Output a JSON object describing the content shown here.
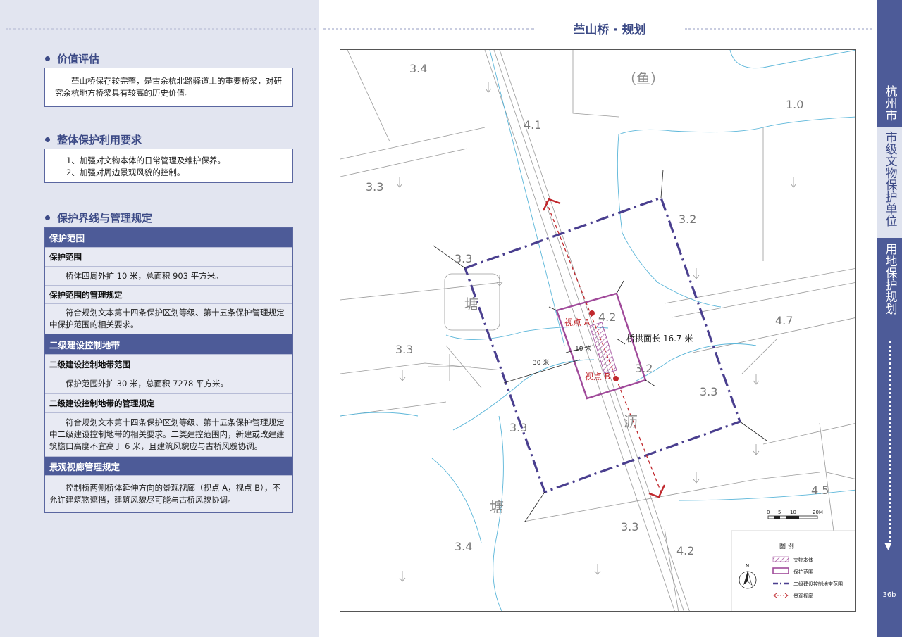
{
  "page_title": "苎山桥 · 规划",
  "sections": {
    "value": {
      "title": "价值评估",
      "text": "苎山桥保存较完整，是古余杭北路驿道上的重要桥梁，对研究余杭地方桥梁具有较高的历史价值。"
    },
    "overall": {
      "title": "整体保护利用要求",
      "items": [
        "1、加强对文物本体的日常管理及维护保养。",
        "2、加强对周边景观风貌的控制。"
      ]
    },
    "boundary": {
      "title": "保护界线与管理规定",
      "rows": [
        {
          "kind": "cat",
          "text": "保护范围"
        },
        {
          "kind": "sub",
          "text": "保护范围"
        },
        {
          "kind": "txt",
          "text": "桥体四周外扩 10 米，总面积 903 平方米。"
        },
        {
          "kind": "sub",
          "text": "保护范围的管理规定"
        },
        {
          "kind": "txt",
          "text": "符合规划文本第十四条保护区划等级、第十五条保护管理规定中保护范围的相关要求。"
        },
        {
          "kind": "cat",
          "text": "二级建设控制地带"
        },
        {
          "kind": "sub",
          "text": "二级建设控制地带范围"
        },
        {
          "kind": "txt",
          "text": "保护范围外扩 30 米，总面积 7278 平方米。"
        },
        {
          "kind": "sub",
          "text": "二级建设控制地带的管理规定"
        },
        {
          "kind": "txt",
          "text": "符合规划文本第十四条保护区划等级、第十五条保护管理规定中二级建设控制地带的相关要求。二类建控范围内，新建或改建建筑檐口高度不宜高于 6 米，且建筑风貌应与古桥风貌协调。"
        },
        {
          "kind": "cat",
          "text": "景观视廊管理规定"
        },
        {
          "kind": "txt",
          "text": "控制桥两侧桥体延伸方向的景观视廊（视点 A，视点 B），不允许建筑物遮挡，建筑风貌尽可能与古桥风貌协调。"
        }
      ]
    }
  },
  "map": {
    "elevations": [
      "3.4",
      "1.0",
      "4.1",
      "3.3",
      "3.2",
      "3.3",
      "4.2",
      "4.7",
      "3.3",
      "3.2",
      "3.3",
      "3.3",
      "4.5",
      "3.3",
      "3.4",
      "4.2"
    ],
    "place_labels": [
      "（鱼）",
      "塘",
      "沥",
      "塘"
    ],
    "viewpoint_a": "视点 A",
    "viewpoint_b": "视点 B",
    "bridge_label": "桥拱面长 16.7 米",
    "dim_10": "10 米",
    "dim_30": "30 米",
    "scale_labels": [
      "0",
      "5",
      "10",
      "20M"
    ],
    "north": "N",
    "legend": {
      "title": "图  例",
      "items": [
        "文物本体",
        "保护范围",
        "二级建设控制地带范围",
        "景观视廊"
      ]
    },
    "colors": {
      "protect": "#a04a9a",
      "control": "#4a3f8f",
      "viewline": "#c0282d",
      "water": "#5bb6d9"
    }
  },
  "sidebar": {
    "items": [
      "杭州市",
      "市级文物保护单位",
      "用地保护规划"
    ],
    "page_number": "36b"
  }
}
